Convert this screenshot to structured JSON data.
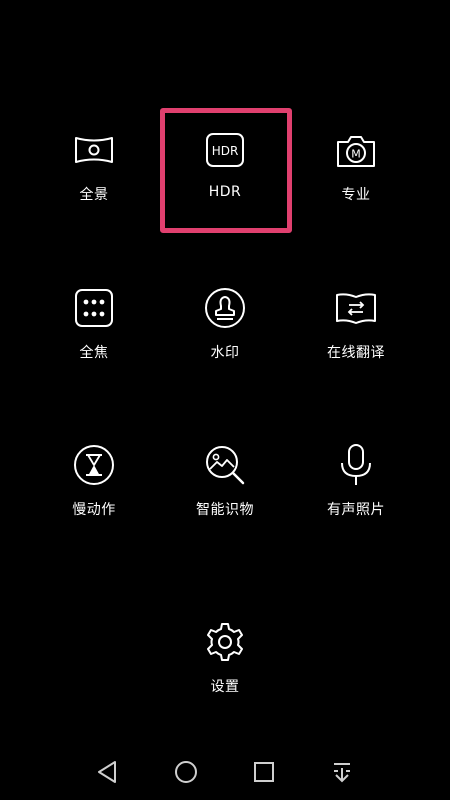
{
  "modes": [
    {
      "label": "全景",
      "icon": "panorama-icon"
    },
    {
      "label": "HDR",
      "icon": "hdr-icon",
      "icon_text": "HDR",
      "selected": true
    },
    {
      "label": "专业",
      "icon": "pro-camera-icon",
      "icon_text": "M"
    },
    {
      "label": "全焦",
      "icon": "all-focus-icon"
    },
    {
      "label": "水印",
      "icon": "watermark-stamp-icon"
    },
    {
      "label": "在线翻译",
      "icon": "translate-book-icon"
    },
    {
      "label": "慢动作",
      "icon": "hourglass-icon"
    },
    {
      "label": "智能识物",
      "icon": "object-recognition-icon"
    },
    {
      "label": "有声照片",
      "icon": "microphone-icon"
    },
    {
      "label": "设置",
      "icon": "gear-icon"
    }
  ],
  "highlight_color": "#e0406f",
  "nav": {
    "back": "back-triangle-icon",
    "home": "home-circle-icon",
    "recents": "recents-square-icon",
    "notifications": "pull-down-icon"
  }
}
